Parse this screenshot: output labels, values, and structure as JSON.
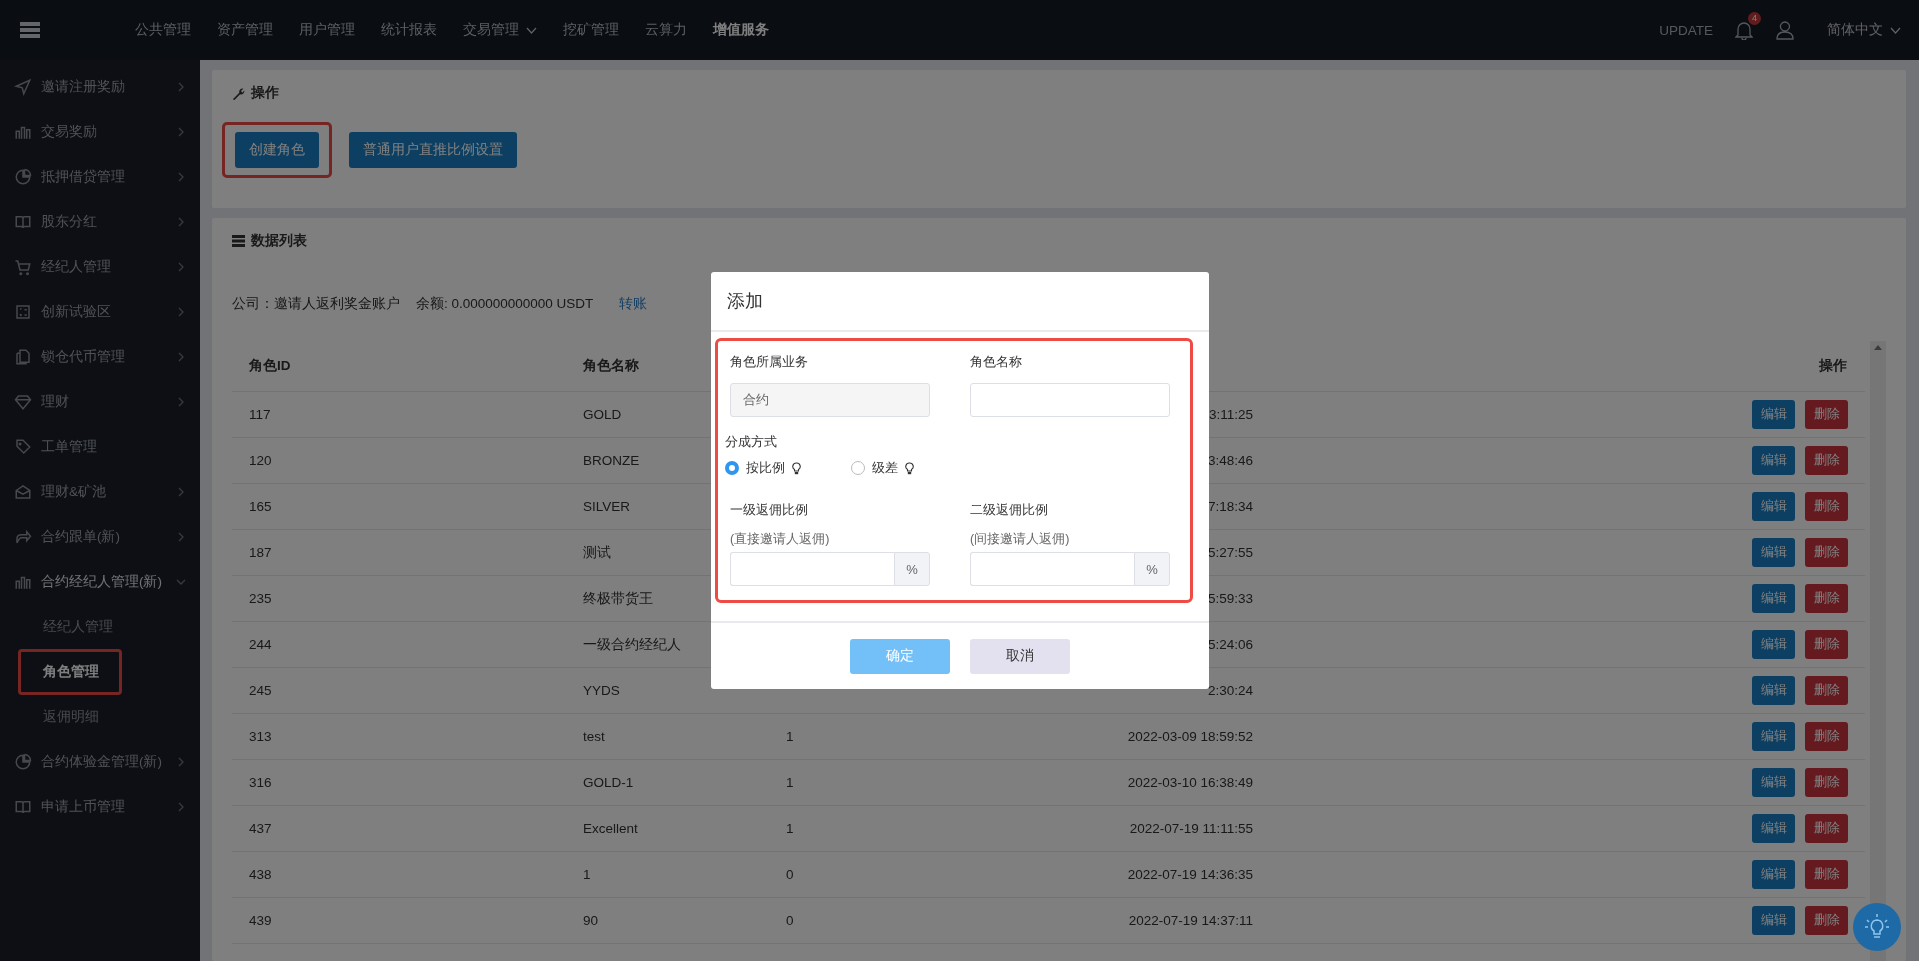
{
  "topbar": {
    "nav": [
      {
        "label": "公共管理",
        "selected": false,
        "dropdown": false
      },
      {
        "label": "资产管理",
        "selected": false,
        "dropdown": false
      },
      {
        "label": "用户管理",
        "selected": false,
        "dropdown": false
      },
      {
        "label": "统计报表",
        "selected": false,
        "dropdown": false
      },
      {
        "label": "交易管理",
        "selected": false,
        "dropdown": true
      },
      {
        "label": "挖矿管理",
        "selected": false,
        "dropdown": false
      },
      {
        "label": "云算力",
        "selected": false,
        "dropdown": false
      },
      {
        "label": "增值服务",
        "selected": true,
        "dropdown": false
      }
    ],
    "update": "UPDATE",
    "notification_count": "4",
    "language": "简体中文"
  },
  "sidebar": {
    "items": [
      {
        "label": "邀请注册奖励",
        "kind": "group",
        "expanded": false
      },
      {
        "label": "交易奖励",
        "kind": "group",
        "expanded": false
      },
      {
        "label": "抵押借贷管理",
        "kind": "group",
        "expanded": false
      },
      {
        "label": "股东分红",
        "kind": "group",
        "expanded": false
      },
      {
        "label": "经纪人管理",
        "kind": "group",
        "expanded": false
      },
      {
        "label": "创新试验区",
        "kind": "group",
        "expanded": false
      },
      {
        "label": "锁仓代币管理",
        "kind": "group",
        "expanded": false
      },
      {
        "label": "理财",
        "kind": "group",
        "expanded": false
      },
      {
        "label": "工单管理",
        "kind": "link"
      },
      {
        "label": "理财&矿池",
        "kind": "group",
        "expanded": false
      },
      {
        "label": "合约跟单(新)",
        "kind": "group",
        "expanded": false
      },
      {
        "label": "合约经纪人管理(新)",
        "kind": "group",
        "expanded": true,
        "children": [
          {
            "label": "经纪人管理",
            "selected": false,
            "highlighted": false
          },
          {
            "label": "角色管理",
            "selected": true,
            "highlighted": true
          },
          {
            "label": "返佣明细",
            "selected": false,
            "highlighted": false
          }
        ]
      },
      {
        "label": "合约体验金管理(新)",
        "kind": "group",
        "expanded": false
      },
      {
        "label": "申请上币管理",
        "kind": "group",
        "expanded": false
      }
    ]
  },
  "operations_panel": {
    "title": "操作",
    "buttons": [
      {
        "label": "创建角色",
        "highlighted": true
      },
      {
        "label": "普通用户直推比例设置",
        "highlighted": false
      }
    ]
  },
  "list_panel": {
    "title": "数据列表",
    "account": "公司：邀请人返利奖金账户",
    "balance": "余额: 0.000000000000 USDT",
    "transfer_link": "转账",
    "table": {
      "header": {
        "id": "角色ID",
        "name": "角色名称",
        "actions": "操作"
      },
      "rows": [
        {
          "id": "117",
          "name": "GOLD",
          "column_4": "3:11:25",
          "actions": [
            {
              "label": "编辑",
              "kind": "edit"
            },
            {
              "label": "删除",
              "kind": "delete"
            }
          ]
        },
        {
          "id": "120",
          "name": "BRONZE",
          "column_4": "3:48:46",
          "actions": [
            {
              "label": "编辑",
              "kind": "edit"
            },
            {
              "label": "删除",
              "kind": "delete"
            }
          ]
        },
        {
          "id": "165",
          "name": "SILVER",
          "column_4": "7:18:34",
          "actions": [
            {
              "label": "编辑",
              "kind": "edit"
            },
            {
              "label": "删除",
              "kind": "delete"
            }
          ]
        },
        {
          "id": "187",
          "name": "测试",
          "column_4": "5:27:55",
          "actions": [
            {
              "label": "编辑",
              "kind": "edit"
            },
            {
              "label": "删除",
              "kind": "delete"
            }
          ]
        },
        {
          "id": "235",
          "name": "终极带货王",
          "column_4": "5:59:33",
          "actions": [
            {
              "label": "编辑",
              "kind": "edit"
            },
            {
              "label": "删除",
              "kind": "delete"
            }
          ]
        },
        {
          "id": "244",
          "name": "一级合约经纪人",
          "column_4": "5:24:06",
          "actions": [
            {
              "label": "编辑",
              "kind": "edit"
            },
            {
              "label": "删除",
              "kind": "delete"
            }
          ]
        },
        {
          "id": "245",
          "name": "YYDS",
          "column_4": "2:30:24",
          "actions": [
            {
              "label": "编辑",
              "kind": "edit"
            },
            {
              "label": "删除",
              "kind": "delete"
            }
          ]
        },
        {
          "id": "313",
          "name": "test",
          "column_3": "1",
          "column_4": "2022-03-09 18:59:52",
          "actions": [
            {
              "label": "编辑",
              "kind": "edit"
            },
            {
              "label": "删除",
              "kind": "delete"
            }
          ]
        },
        {
          "id": "316",
          "name": "GOLD-1",
          "column_3": "1",
          "column_4": "2022-03-10 16:38:49",
          "actions": [
            {
              "label": "编辑",
              "kind": "edit"
            },
            {
              "label": "删除",
              "kind": "delete"
            }
          ]
        },
        {
          "id": "437",
          "name": "Excellent",
          "column_3": "1",
          "column_4": "2022-07-19 11:11:55",
          "actions": [
            {
              "label": "编辑",
              "kind": "edit"
            },
            {
              "label": "删除",
              "kind": "delete"
            }
          ]
        },
        {
          "id": "438",
          "name": "1",
          "column_3": "0",
          "column_4": "2022-07-19 14:36:35",
          "actions": [
            {
              "label": "编辑",
              "kind": "edit"
            },
            {
              "label": "删除",
              "kind": "delete"
            }
          ]
        },
        {
          "id": "439",
          "name": "90",
          "column_3": "0",
          "column_4": "2022-07-19 14:37:11",
          "actions": [
            {
              "label": "编辑",
              "kind": "edit"
            },
            {
              "label": "删除",
              "kind": "delete"
            }
          ]
        }
      ]
    }
  },
  "dialog": {
    "title": "添加",
    "highlighted": true,
    "business": {
      "label": "角色所属业务",
      "value": "合约"
    },
    "role_name": {
      "label": "角色名称"
    },
    "split": {
      "label": "分成方式",
      "options": [
        {
          "label": "按比例",
          "selected": true
        },
        {
          "label": "级差",
          "selected": false
        }
      ]
    },
    "rates": [
      {
        "label": "一级返佣比例",
        "hint": "(直接邀请人返佣)",
        "suffix": "%"
      },
      {
        "label": "二级返佣比例",
        "hint": "(间接邀请人返佣)",
        "suffix": "%"
      }
    ],
    "buttons": [
      {
        "label": "确定",
        "kind": "primary",
        "disabled": true
      },
      {
        "label": "取消",
        "kind": "default",
        "disabled": false
      }
    ]
  }
}
